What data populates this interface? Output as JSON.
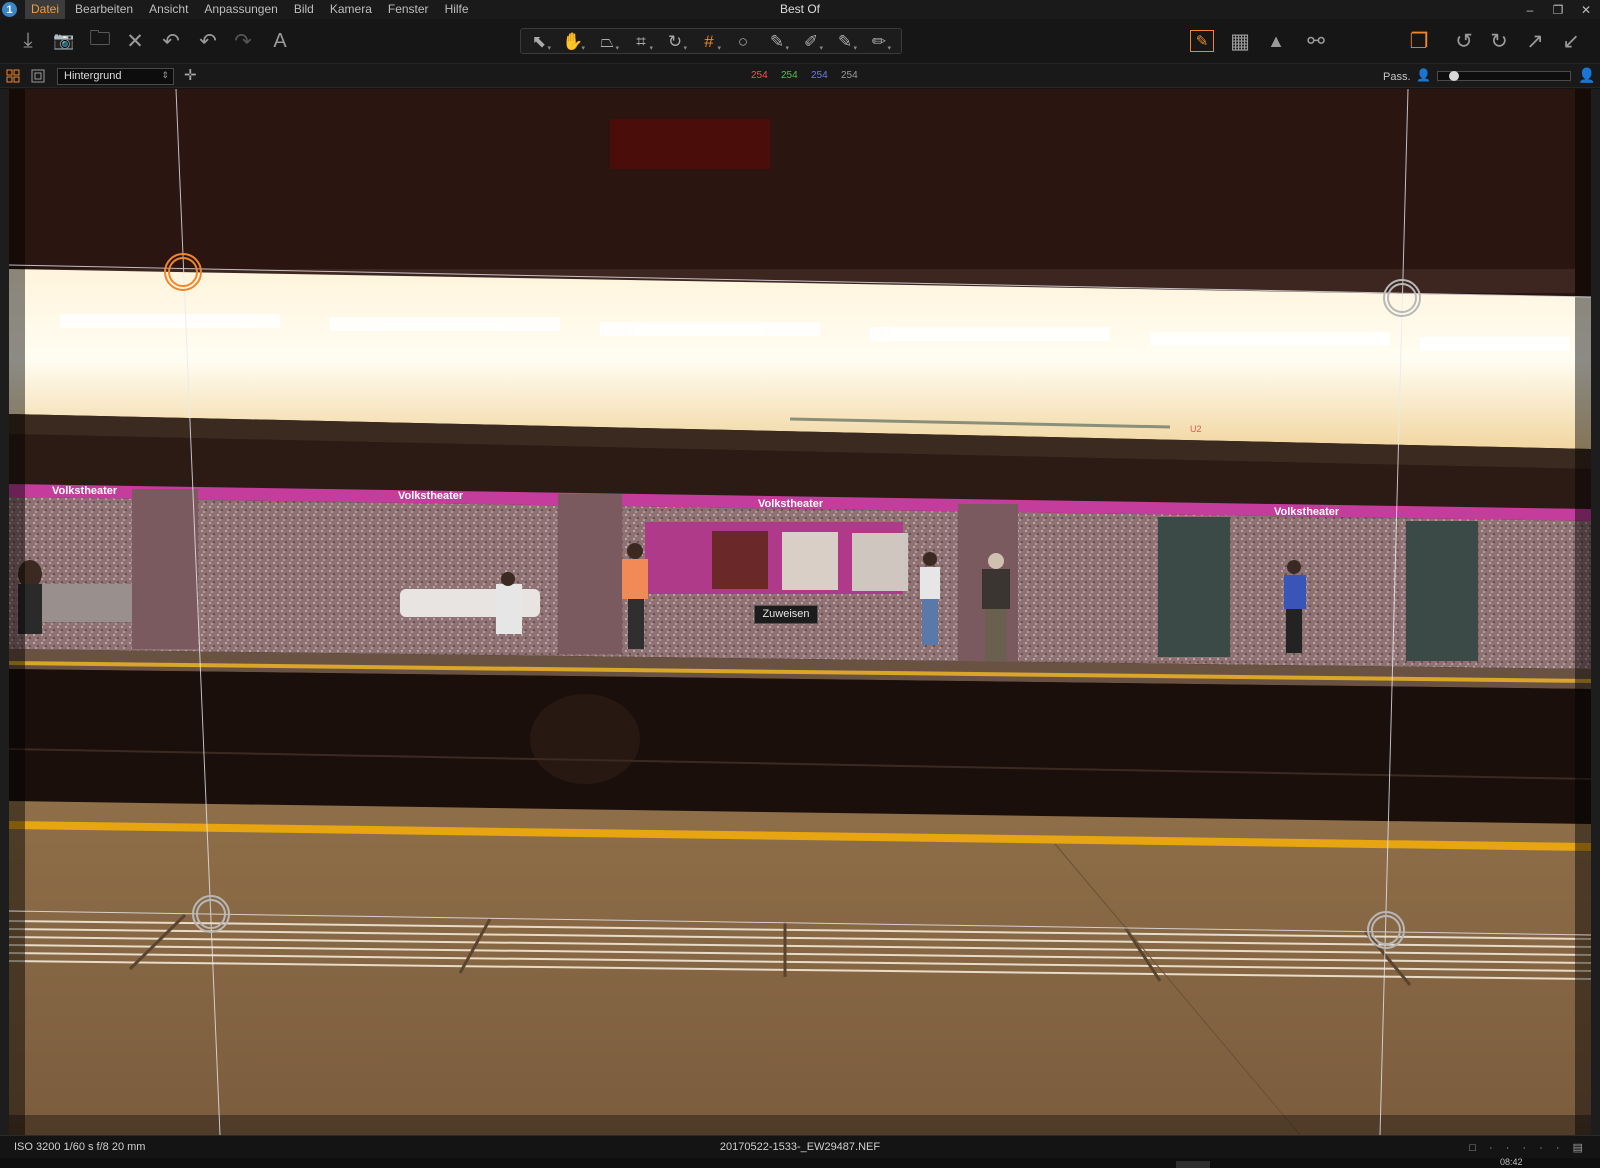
{
  "app": {
    "icon_glyph": "1",
    "window_title": "Best Of"
  },
  "menu": [
    "Datei",
    "Bearbeiten",
    "Ansicht",
    "Anpassungen",
    "Bild",
    "Kamera",
    "Fenster",
    "Hilfe"
  ],
  "window_controls": {
    "minimize": "–",
    "restore": "❐",
    "close": "✕"
  },
  "toolbar": {
    "left": [
      {
        "name": "import-icon",
        "glyph": "⤓"
      },
      {
        "name": "camera-icon",
        "glyph": "📷"
      },
      {
        "name": "folder-icon",
        "glyph": "🗀"
      },
      {
        "name": "delete-icon",
        "glyph": "✕"
      },
      {
        "name": "reset-icon",
        "glyph": "↶"
      },
      {
        "name": "undo-icon",
        "glyph": "↶"
      },
      {
        "name": "redo-icon",
        "glyph": "↷"
      },
      {
        "name": "text-tool-icon",
        "glyph": "A"
      }
    ],
    "tools": [
      {
        "name": "select-tool-icon",
        "glyph": "⬉"
      },
      {
        "name": "pan-tool-icon",
        "glyph": "✋"
      },
      {
        "name": "keystone-tool-icon",
        "glyph": "⏢"
      },
      {
        "name": "crop-tool-icon",
        "glyph": "⌗"
      },
      {
        "name": "rotate-tool-icon",
        "glyph": "↻"
      },
      {
        "name": "grid-keystone-tool-icon",
        "glyph": "#"
      },
      {
        "name": "circle-tool-icon",
        "glyph": "○"
      },
      {
        "name": "brush-tool-icon",
        "glyph": "✎"
      },
      {
        "name": "gradient-brush-tool-icon",
        "glyph": "✐"
      },
      {
        "name": "erase-tool-icon",
        "glyph": "✎"
      },
      {
        "name": "pen-tool-icon",
        "glyph": "✏"
      }
    ],
    "right": [
      {
        "name": "edit-mask-icon",
        "glyph": "✎"
      },
      {
        "name": "grid-overlay-icon",
        "glyph": "▦"
      },
      {
        "name": "exposure-warning-icon",
        "glyph": "▲"
      },
      {
        "name": "proof-glasses-icon",
        "glyph": "⚯"
      },
      {
        "name": "copy-adjustments-icon",
        "glyph": "❐"
      },
      {
        "name": "rotate-left-icon",
        "glyph": "↺"
      },
      {
        "name": "rotate-right-icon",
        "glyph": "↻"
      },
      {
        "name": "export-arrow-icon",
        "glyph": "↗"
      },
      {
        "name": "apply-arrow-icon",
        "glyph": "↙"
      }
    ]
  },
  "subbar": {
    "layer": "Hintergrund",
    "rgb": [
      {
        "value": "254",
        "color": "#e05a4f"
      },
      {
        "value": "254",
        "color": "#4fc04f"
      },
      {
        "value": "254",
        "color": "#6f78e8"
      },
      {
        "value": "254",
        "color": "#9a9a9a"
      }
    ],
    "pass_label": "Pass.",
    "zoom_level": 0.09
  },
  "viewer": {
    "tooltip": "Zuweisen",
    "signs": [
      "Volkstheater",
      "Volkstheater",
      "Volkstheater",
      "Volkstheater"
    ],
    "ubahn_label": "U2"
  },
  "statusbar": {
    "exif": "ISO 3200  1/60 s  f/8  20 mm",
    "filename": "20170522-1533-_EW29487.NEF",
    "icons": "□ · · · · · ▤",
    "bottom_text": "08:42"
  },
  "colors": {
    "accent": "#f0862c",
    "active_menu": "#f19a38",
    "magenta_signs": "#c43c9c",
    "platform_yellow": "#e6a511"
  }
}
